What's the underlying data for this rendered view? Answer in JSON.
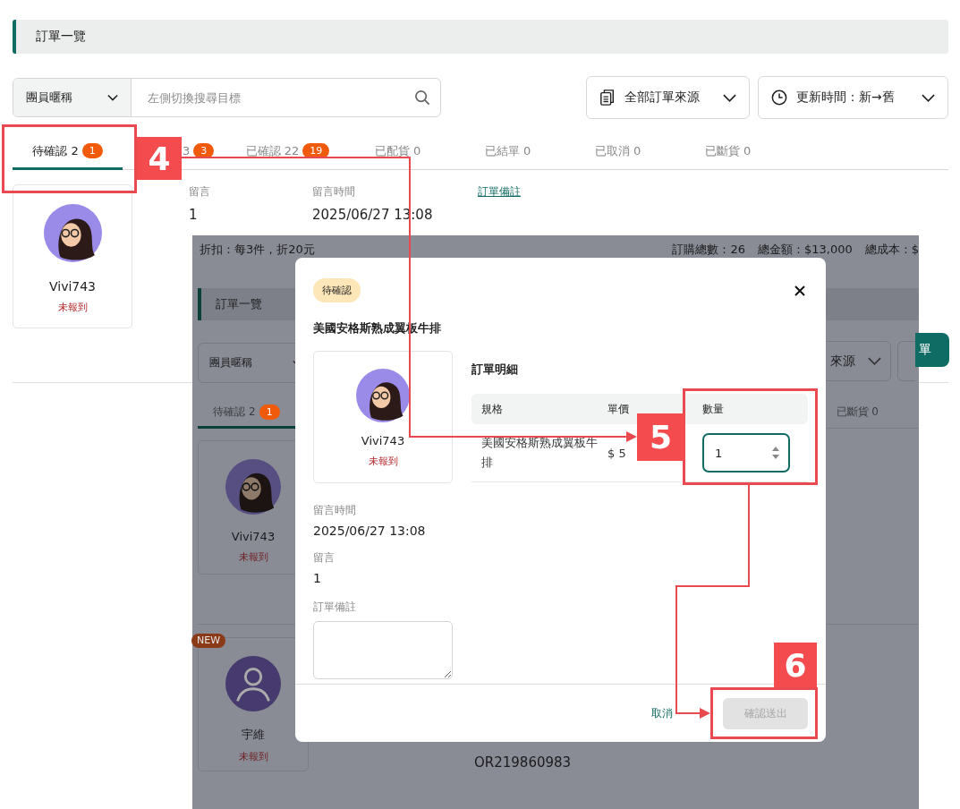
{
  "page": {
    "title": "訂單一覽",
    "member_filter": "團員暱稱",
    "search": {
      "placeholder": "左側切換搜尋目標"
    },
    "source_filter": "全部訂單來源",
    "sort": "更新時間：新→舊",
    "tabs": [
      {
        "label": "待確認 2",
        "count": "1",
        "selected": true
      },
      {
        "label": "3",
        "count": "3",
        "selected": false
      },
      {
        "label": "已確認 22",
        "count": "19",
        "selected": false
      },
      {
        "label": "已配貨 0",
        "selected": false
      },
      {
        "label": "已結單 0",
        "selected": false
      },
      {
        "label": "已取消 0",
        "selected": false
      },
      {
        "label": "已斷貨 0",
        "selected": false
      }
    ],
    "order": {
      "member": {
        "name": "Vivi743",
        "status": "未報到",
        "kind": "illustrated"
      },
      "fields": [
        {
          "label": "留言",
          "value": "1"
        },
        {
          "label": "留言時間",
          "value": "2025/06/27 13:08"
        }
      ],
      "link": "訂單備註"
    }
  },
  "inset": {
    "discount": "折扣：每3件，折20元",
    "totals": [
      "訂購總數：26",
      "總金額：$13,000",
      "總成本：$"
    ],
    "title": "訂單一覽",
    "member_filter": "團員暱稱",
    "source_filter": "來源",
    "action_button": "單",
    "tabs": [
      {
        "label": "待確認 2",
        "count": "1",
        "selected": true
      },
      {
        "label": "已斷貨 0",
        "selected": false
      }
    ],
    "members": [
      {
        "name": "Vivi743",
        "status": "未報到",
        "kind": "illustrated"
      },
      {
        "name": "宇維",
        "status": "未報到",
        "kind": "default",
        "badge": "NEW"
      }
    ],
    "order_number": "OR219860983"
  },
  "modal": {
    "status": "待確認",
    "title": "美國安格斯熟成翼板牛排",
    "member": {
      "name": "Vivi743",
      "status": "未報到",
      "kind": "illustrated"
    },
    "fields": [
      {
        "label": "留言時間",
        "value": "2025/06/27 13:08"
      },
      {
        "label": "留言",
        "value": "1"
      }
    ],
    "note_label": "訂單備註",
    "detail_title": "訂單明細",
    "columns": [
      "規格",
      "單價",
      "數量"
    ],
    "rows": [
      {
        "spec": "美國安格斯熟成翼板牛排",
        "price": "$ 5",
        "quantity": "1"
      }
    ],
    "cancel": "取消",
    "confirm": {
      "label": "確認送出",
      "disabled": true
    }
  },
  "callouts": [
    "4",
    "5",
    "6"
  ]
}
